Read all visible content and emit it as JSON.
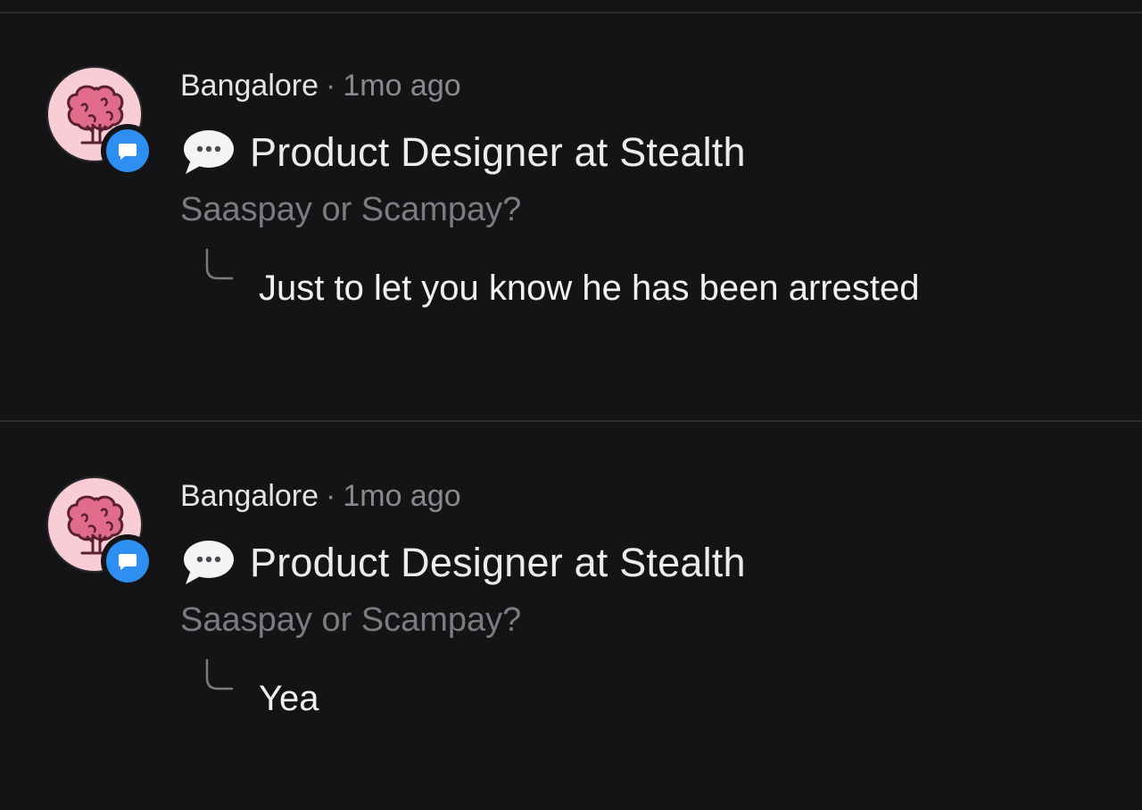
{
  "posts": [
    {
      "location": "Bangalore",
      "separator": "·",
      "time": "1mo ago",
      "title": "Product Designer at Stealth",
      "question": "Saaspay or Scampay?",
      "reply": "Just to let you know he has been arrested"
    },
    {
      "location": "Bangalore",
      "separator": "·",
      "time": "1mo ago",
      "title": "Product Designer at Stealth",
      "question": "Saaspay or Scampay?",
      "reply": "Yea"
    }
  ],
  "icons": {
    "avatar": "tree-avatar-icon",
    "badge": "chat-badge-icon",
    "title": "speech-bubble-icon",
    "reply": "reply-thread-icon"
  },
  "colors": {
    "background": "#141416",
    "avatar_bg": "#f8cdd6",
    "tree": "#e06b8b",
    "badge": "#2f8ff0",
    "divider": "#2a2a2d"
  }
}
